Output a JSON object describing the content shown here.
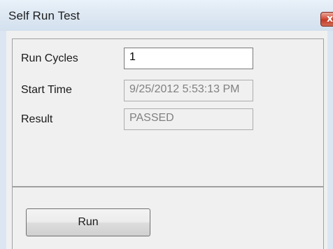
{
  "window": {
    "title": "Self Run Test",
    "close_glyph": "x"
  },
  "form": {
    "run_cycles": {
      "label": "Run Cycles",
      "value": "1"
    },
    "start_time": {
      "label": "Start Time",
      "value": "9/25/2012 5:53:13 PM"
    },
    "result": {
      "label": "Result",
      "value": "PASSED"
    }
  },
  "actions": {
    "run_label": "Run"
  },
  "icons": {
    "close": "close-icon"
  },
  "colors": {
    "titlebar": "#dce7f2",
    "close_button": "#c13a26",
    "background": "#f0f0f0",
    "readonly_text": "#808080"
  }
}
